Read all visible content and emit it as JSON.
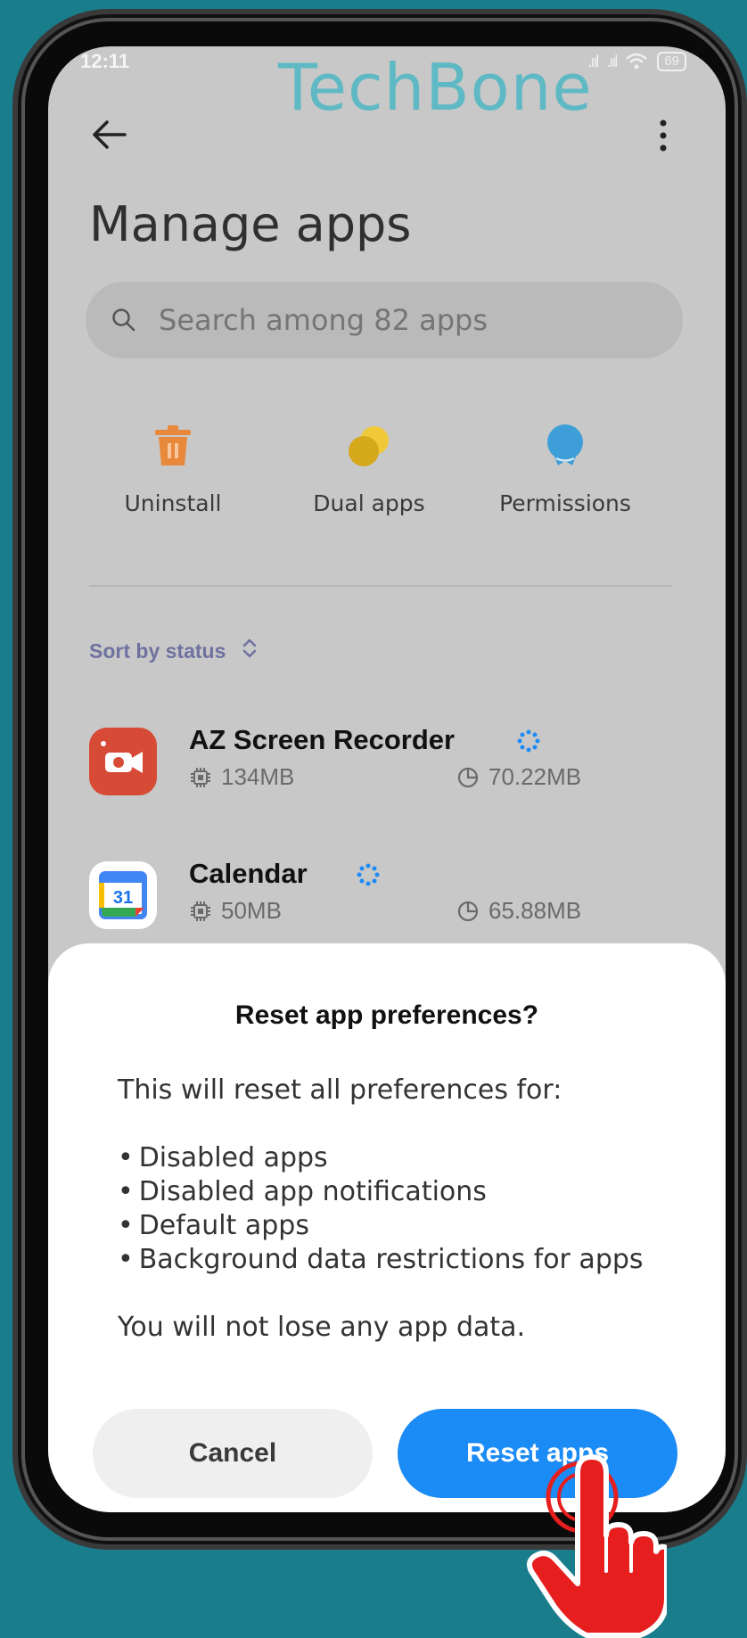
{
  "status_bar": {
    "time": "12:11",
    "signal1": ".ııl",
    "signal2": ".ııl",
    "battery": "69"
  },
  "watermark": "TechBone",
  "header": {
    "title": "Manage apps"
  },
  "search": {
    "placeholder": "Search among 82 apps"
  },
  "actions": [
    {
      "label": "Uninstall",
      "icon": "trash-icon",
      "color": "#e8883a"
    },
    {
      "label": "Dual apps",
      "icon": "dual-apps-icon",
      "color": "#e2b82a"
    },
    {
      "label": "Permissions",
      "icon": "permissions-icon",
      "color": "#3d9ed8"
    }
  ],
  "sort": {
    "label": "Sort by status"
  },
  "apps": [
    {
      "name": "AZ Screen Recorder",
      "size": "134MB",
      "storage": "70.22MB",
      "icon_color": "#d64a36"
    },
    {
      "name": "Calendar",
      "size": "50MB",
      "storage": "65.88MB",
      "icon_color": "#ffffff"
    }
  ],
  "calendar_icon_text": "31",
  "dialog": {
    "title": "Reset app preferences?",
    "intro": "This will reset all preferences for:",
    "items": [
      "Disabled apps",
      "Disabled app notifications",
      "Default apps",
      "Background data restrictions for apps"
    ],
    "outro": "You will not lose any app data.",
    "cancel_label": "Cancel",
    "reset_label": "Reset apps"
  },
  "colors": {
    "background": "#1a7d8c",
    "accent": "#1b8bf5",
    "hand": "#e61e1e"
  }
}
